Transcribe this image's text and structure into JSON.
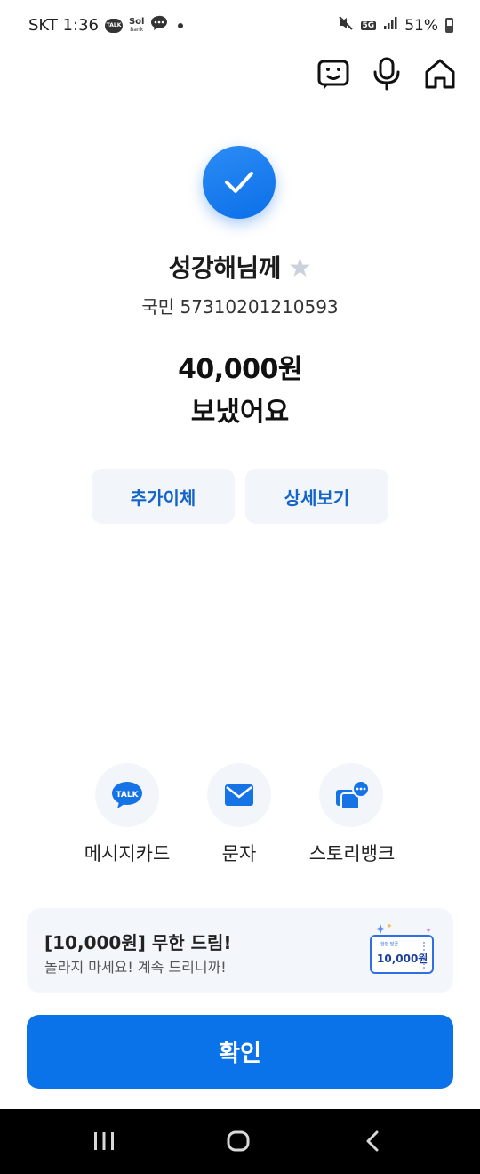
{
  "status_bar": {
    "carrier_time": "SKT 1:36",
    "talk_badge": "TALK",
    "sol_brand": "Sol",
    "sol_sub": "Bank",
    "network": "5G",
    "battery": "51%",
    "icons": [
      "talk-icon",
      "sol-bank-icon",
      "chat-icon",
      "notification-dot-icon",
      "mute-icon",
      "signal-icon",
      "battery-icon"
    ]
  },
  "header": {
    "icons": [
      "chatbot-icon",
      "microphone-icon",
      "home-icon"
    ]
  },
  "result": {
    "recipient": "성강해님께",
    "account": "국민 57310201210593",
    "amount": "40,000원",
    "status": "보냈어요"
  },
  "actions": {
    "additional_transfer": "추가이체",
    "details": "상세보기"
  },
  "share": {
    "items": [
      {
        "label": "메시지카드",
        "icon": "kakaotalk-icon",
        "icon_text": "TALK"
      },
      {
        "label": "문자",
        "icon": "envelope-icon"
      },
      {
        "label": "스토리뱅크",
        "icon": "story-bank-icon"
      }
    ]
  },
  "banner": {
    "title": "[10,000원] 무한 드림!",
    "subtitle": "놀라지 마세요! 계속 드리니까!",
    "coupon_caption": "한번 발급",
    "coupon_value": "10,000원"
  },
  "confirm_label": "확인",
  "nav_bar": {
    "icons": [
      "recent-apps-icon",
      "home-button-icon",
      "back-icon"
    ]
  },
  "colors": {
    "accent": "#0b73ea",
    "soft_button_bg": "#f2f5fa",
    "soft_button_text": "#1565c8",
    "star": "#ccd2dc"
  }
}
